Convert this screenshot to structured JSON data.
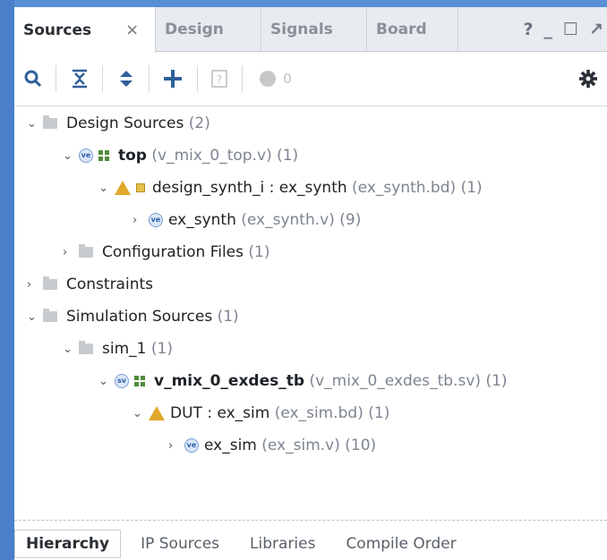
{
  "tabs": [
    {
      "label": "Sources"
    },
    {
      "label": "Design"
    },
    {
      "label": "Signals"
    },
    {
      "label": "Board"
    }
  ],
  "tab_close_glyph": "×",
  "window_controls": {
    "help": "?",
    "minimize": "_",
    "restore": "☐",
    "float": "↗"
  },
  "toolbar": {
    "search_icon": "search-icon",
    "collapse_icon": "collapse-all-icon",
    "expand_icon": "expand-all-icon",
    "add_icon": "add-sources-icon",
    "help_icon": "question-icon",
    "status_count": "0",
    "gear_icon": "gear-icon"
  },
  "tree": {
    "design_sources": {
      "label": "Design Sources",
      "count": "(2)"
    },
    "top": {
      "label": "top",
      "file": "(v_mix_0_top.v)",
      "count": "(1)"
    },
    "design_synth": {
      "label": "design_synth_i : ex_synth",
      "file": "(ex_synth.bd)",
      "count": "(1)"
    },
    "ex_synth": {
      "label": "ex_synth",
      "file": "(ex_synth.v)",
      "count": "(9)"
    },
    "config_files": {
      "label": "Configuration Files",
      "count": "(1)"
    },
    "constraints": {
      "label": "Constraints"
    },
    "simulation_sources": {
      "label": "Simulation Sources",
      "count": "(1)"
    },
    "sim_1": {
      "label": "sim_1",
      "count": "(1)"
    },
    "exdes_tb": {
      "label": "v_mix_0_exdes_tb",
      "file": "(v_mix_0_exdes_tb.sv)",
      "count": "(1)"
    },
    "dut": {
      "label": "DUT : ex_sim",
      "file": "(ex_sim.bd)",
      "count": "(1)"
    },
    "ex_sim": {
      "label": "ex_sim",
      "file": "(ex_sim.v)",
      "count": "(10)"
    }
  },
  "bottom_tabs": [
    {
      "label": "Hierarchy"
    },
    {
      "label": "IP Sources"
    },
    {
      "label": "Libraries"
    },
    {
      "label": "Compile Order"
    }
  ]
}
